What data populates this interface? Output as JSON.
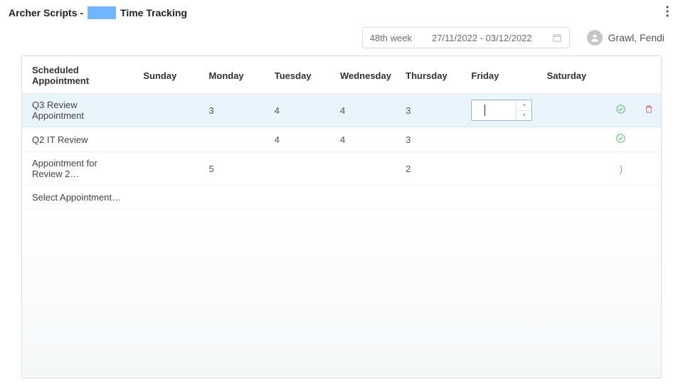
{
  "header": {
    "title_prefix": "Archer Scripts -",
    "title_suffix": "Time Tracking"
  },
  "week": {
    "label": "48th week",
    "range": "27/11/2022 - 03/12/2022"
  },
  "user": {
    "display_name": "Grawl, Fendi"
  },
  "table": {
    "columns": {
      "appointment": "Scheduled Appointment",
      "sunday": "Sunday",
      "monday": "Monday",
      "tuesday": "Tuesday",
      "wednesday": "Wednesday",
      "thursday": "Thursday",
      "friday": "Friday",
      "saturday": "Saturday"
    },
    "rows": [
      {
        "appointment": "Q3 Review Appointment",
        "sunday": "",
        "monday": "3",
        "tuesday": "4",
        "wednesday": "4",
        "thursday": "3",
        "friday_editing": true,
        "friday": "",
        "saturday": "",
        "status": "ok",
        "deletable": true,
        "active": true
      },
      {
        "appointment": "Q2 IT Review",
        "sunday": "",
        "monday": "",
        "tuesday": "4",
        "wednesday": "4",
        "thursday": "3",
        "friday": "",
        "saturday": "",
        "status": "ok",
        "deletable": false
      },
      {
        "appointment": "Appointment for Review 2…",
        "sunday": "",
        "monday": "5",
        "tuesday": "",
        "wednesday": "",
        "thursday": "2",
        "friday": "",
        "saturday": "",
        "status": "loading",
        "deletable": false
      }
    ],
    "placeholder_row": "Select Appointment…"
  }
}
